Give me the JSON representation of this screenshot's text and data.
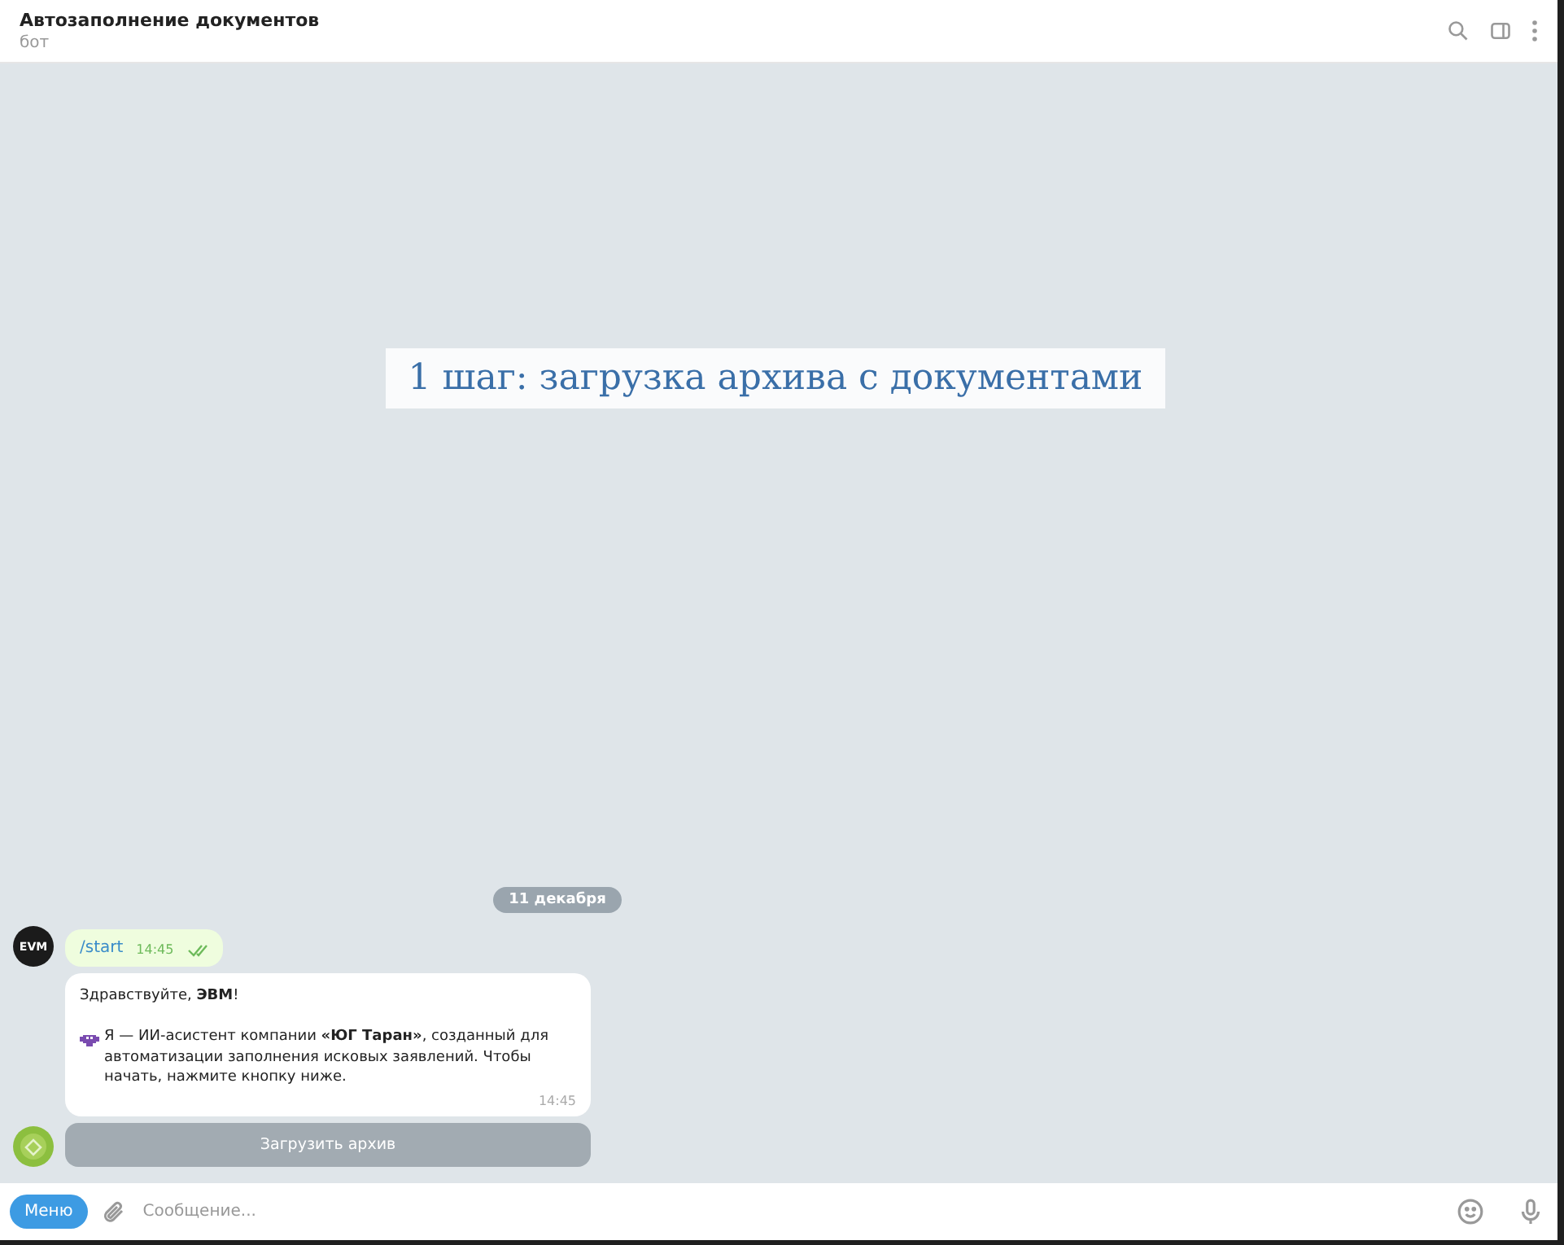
{
  "header": {
    "title": "Автозаполнение документов",
    "subtitle": "бот"
  },
  "banner": {
    "text": "1 шаг: загрузка архива с документами"
  },
  "date_separator": "11 декабря",
  "messages": [
    {
      "kind": "outgoing",
      "avatar_label": "EVM",
      "text": "/start",
      "time": "14:45",
      "read": true
    },
    {
      "kind": "incoming",
      "paragraphs": [
        "Здравствуйте, **ЭВМ**!",
        "Я — ИИ-асистент компании **«ЮГ Таран»**, созданный для автоматизации заполнения исковых заявлений. Чтобы начать, нажмите кнопку ниже."
      ],
      "time": "14:45",
      "buttons": [
        "Загрузить архив"
      ]
    }
  ],
  "composer": {
    "menu_button": "Меню",
    "placeholder": "Сообщение..."
  }
}
